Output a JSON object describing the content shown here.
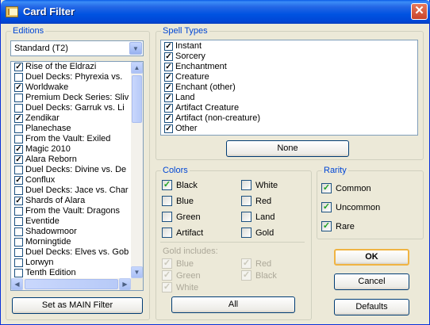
{
  "window": {
    "title": "Card Filter",
    "close_glyph": "✕",
    "accent": "#0046d5"
  },
  "editions": {
    "legend": "Editions",
    "selected_format": "Standard (T2)",
    "items": [
      {
        "label": "Rise of the Eldrazi",
        "checked": true
      },
      {
        "label": "Duel Decks: Phyrexia vs.",
        "checked": false
      },
      {
        "label": "Worldwake",
        "checked": true
      },
      {
        "label": "Premium Deck Series: Sliv",
        "checked": false
      },
      {
        "label": "Duel Decks: Garruk vs. Li",
        "checked": false
      },
      {
        "label": "Zendikar",
        "checked": true
      },
      {
        "label": "Planechase",
        "checked": false
      },
      {
        "label": "From the Vault: Exiled",
        "checked": false
      },
      {
        "label": "Magic 2010",
        "checked": true
      },
      {
        "label": "Alara Reborn",
        "checked": true
      },
      {
        "label": "Duel Decks: Divine vs. De",
        "checked": false
      },
      {
        "label": "Conflux",
        "checked": true
      },
      {
        "label": "Duel Decks: Jace vs. Char",
        "checked": false
      },
      {
        "label": "Shards of Alara",
        "checked": true
      },
      {
        "label": "From the Vault: Dragons",
        "checked": false
      },
      {
        "label": "Eventide",
        "checked": false
      },
      {
        "label": "Shadowmoor",
        "checked": false
      },
      {
        "label": "Morningtide",
        "checked": false
      },
      {
        "label": "Duel Decks: Elves vs. Gob",
        "checked": false
      },
      {
        "label": "Lorwyn",
        "checked": false
      },
      {
        "label": "Tenth Edition",
        "checked": false
      }
    ],
    "main_filter_button": "Set as MAIN Filter"
  },
  "spell_types": {
    "legend": "Spell Types",
    "items": [
      {
        "label": "Instant",
        "checked": true
      },
      {
        "label": "Sorcery",
        "checked": true
      },
      {
        "label": "Enchantment",
        "checked": true
      },
      {
        "label": "Creature",
        "checked": true
      },
      {
        "label": "Enchant (other)",
        "checked": true
      },
      {
        "label": "Land",
        "checked": true
      },
      {
        "label": "Artifact Creature",
        "checked": true
      },
      {
        "label": "Artifact (non-creature)",
        "checked": true
      },
      {
        "label": "Other",
        "checked": true
      }
    ],
    "none_button": "None"
  },
  "colors": {
    "legend": "Colors",
    "items": [
      {
        "label": "Black",
        "checked": true
      },
      {
        "label": "White",
        "checked": false
      },
      {
        "label": "Blue",
        "checked": false
      },
      {
        "label": "Red",
        "checked": false
      },
      {
        "label": "Green",
        "checked": false
      },
      {
        "label": "Land",
        "checked": false
      },
      {
        "label": "Artifact",
        "checked": false
      },
      {
        "label": "Gold",
        "checked": false
      }
    ],
    "gold_includes_label": "Gold includes:",
    "gold_items": [
      {
        "label": "Blue",
        "checked": true
      },
      {
        "label": "Red",
        "checked": true
      },
      {
        "label": "Green",
        "checked": true
      },
      {
        "label": "Black",
        "checked": true
      },
      {
        "label": "White",
        "checked": true
      }
    ],
    "all_button": "All"
  },
  "rarity": {
    "legend": "Rarity",
    "items": [
      {
        "label": "Common",
        "checked": true
      },
      {
        "label": "Uncommon",
        "checked": true
      },
      {
        "label": "Rare",
        "checked": true
      }
    ]
  },
  "actions": {
    "ok": "OK",
    "cancel": "Cancel",
    "defaults": "Defaults"
  }
}
